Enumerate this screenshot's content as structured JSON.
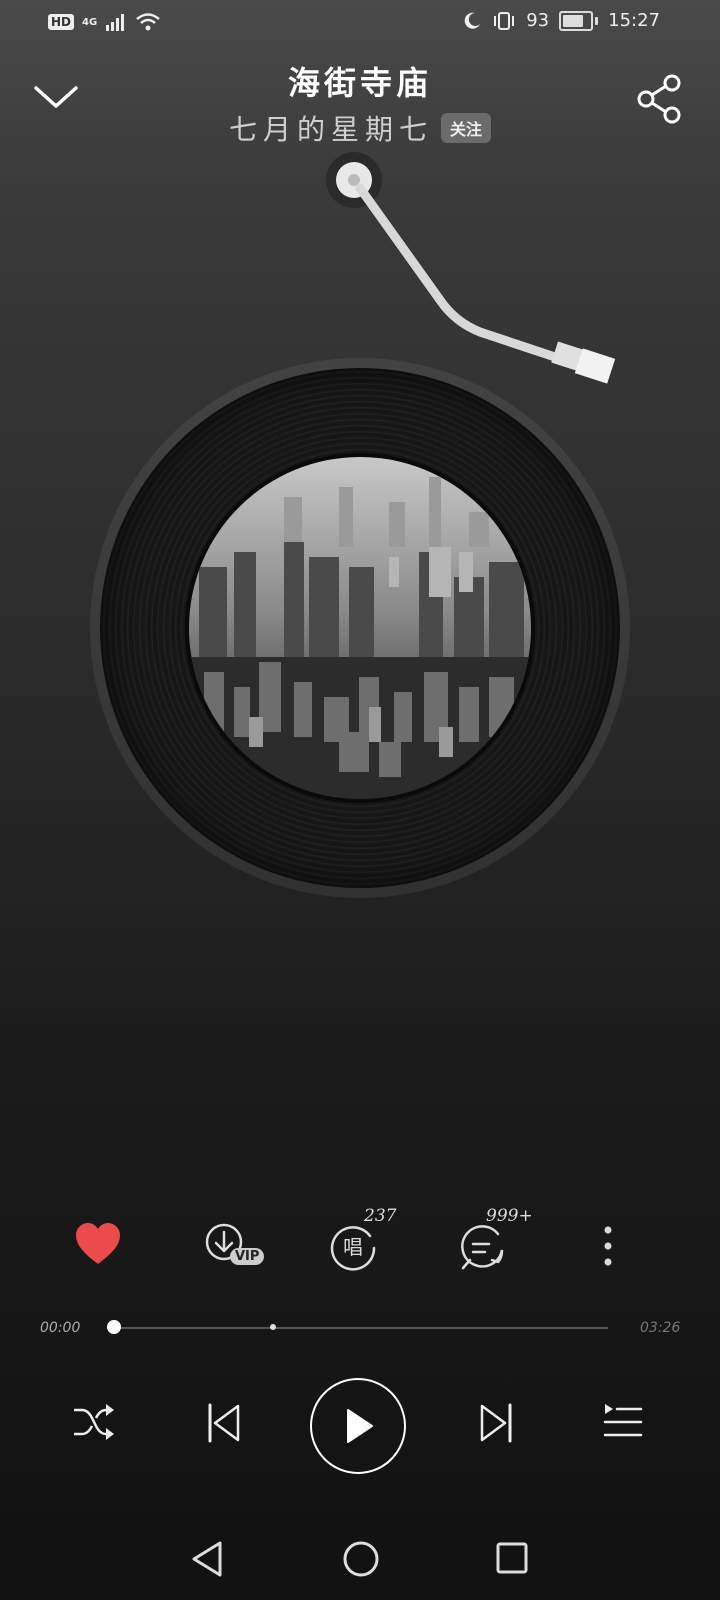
{
  "status_bar": {
    "left_badge": "HD",
    "network": "4G",
    "battery_text": "93",
    "battery_level": 0.93,
    "time": "15:27"
  },
  "song": {
    "title": "海街寺庙",
    "artist": "七月的星期七",
    "follow_label": "关注"
  },
  "actions": {
    "vip_label": "VIP",
    "sing_count": "237",
    "comment_count": "999+"
  },
  "progress": {
    "current_time": "00:00",
    "total_time": "03:26",
    "played_fraction": 0.0
  },
  "colors": {
    "accent_heart": "#ea4c4c"
  },
  "icons": {
    "collapse": "chevron-down-icon",
    "share": "share-icon",
    "favorite": "heart-icon",
    "download": "download-icon",
    "sing": "microphone-sing-icon",
    "comment": "comment-icon",
    "more": "more-vertical-icon",
    "shuffle": "shuffle-icon",
    "previous": "previous-icon",
    "play": "play-icon",
    "next": "next-icon",
    "playlist": "playlist-icon"
  }
}
